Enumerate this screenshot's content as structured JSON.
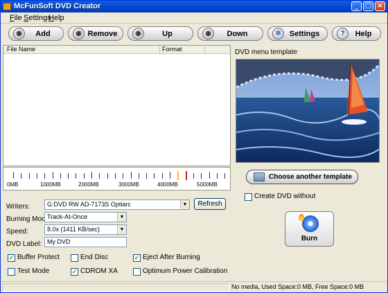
{
  "window": {
    "title": "McFunSoft DVD Creator"
  },
  "menu": [
    "File",
    "Settings",
    "Help"
  ],
  "toolbar": [
    {
      "label": "Add",
      "icon": "add-icon"
    },
    {
      "label": "Remove",
      "icon": "remove-icon"
    },
    {
      "label": "Up",
      "icon": "up-icon"
    },
    {
      "label": "Down",
      "icon": "down-icon"
    },
    {
      "label": "Settings",
      "icon": "settings-icon"
    },
    {
      "label": "Help",
      "icon": "help-icon"
    }
  ],
  "file_list": {
    "columns": [
      "File Name",
      "Format"
    ],
    "rows": []
  },
  "capacity": {
    "ticks": [
      "0MB",
      "1000MB",
      "2000MB",
      "3000MB",
      "4000MB",
      "5000MB"
    ]
  },
  "options": {
    "writers_label": "Writers:",
    "writer_value": "G:DVD RW AD-7173S Optiarc",
    "refresh_label": "Refresh",
    "burning_mode_label": "Burning Mode:",
    "burning_mode_value": "Track-At-Once",
    "speed_label": "Speed:",
    "speed_value": "8.0x (1411 KB/sec)",
    "dvd_label_label": "DVD Label:",
    "dvd_label_value": "My DVD",
    "checkboxes": [
      {
        "label": "Buffer Protect",
        "checked": true
      },
      {
        "label": "End Disc",
        "checked": false
      },
      {
        "label": "Eject After Burning",
        "checked": true
      },
      {
        "label": "Test Mode",
        "checked": false
      },
      {
        "label": "CDROM XA",
        "checked": true
      },
      {
        "label": "Optimum Power Calibration",
        "checked": false
      }
    ]
  },
  "template": {
    "title": "DVD menu template",
    "choose_label": "Choose another template",
    "create_without_label": "Create DVD without",
    "burn_label": "Burn"
  },
  "status": {
    "text": "No media, Used Space:0 MB, Free Space:0 MB"
  }
}
